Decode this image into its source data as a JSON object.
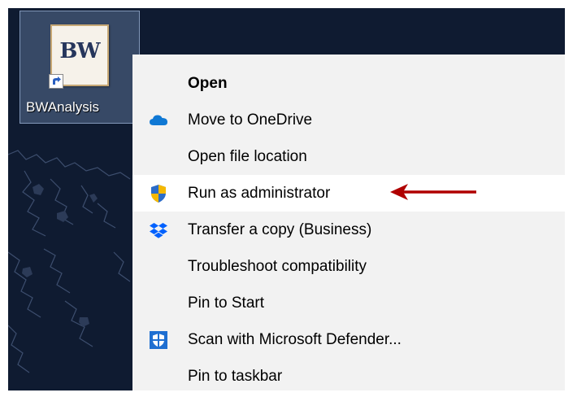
{
  "desktop": {
    "shortcut": {
      "label": "BWAnalysis",
      "icon": "bw-app-icon",
      "logo_text": "BW",
      "overlay": "shortcut-arrow-icon"
    },
    "background": "world-map-wallpaper"
  },
  "context_menu": {
    "items": [
      {
        "label": "Open",
        "bold": true,
        "icon": null
      },
      {
        "label": "Move to OneDrive",
        "icon": "onedrive-icon"
      },
      {
        "label": "Open file location",
        "icon": null
      },
      {
        "label": "Run as administrator",
        "icon": "uac-shield-icon",
        "highlighted": true
      },
      {
        "label": "Transfer a copy (Business)",
        "icon": "dropbox-icon"
      },
      {
        "label": "Troubleshoot compatibility",
        "icon": null
      },
      {
        "label": "Pin to Start",
        "icon": null
      },
      {
        "label": "Scan with Microsoft Defender...",
        "icon": "defender-icon"
      },
      {
        "label": "Pin to taskbar",
        "icon": null
      }
    ]
  },
  "annotation": {
    "arrow_color": "#b00000",
    "points_to": "Run as administrator"
  },
  "colors": {
    "desktop_bg": "#0f1b31",
    "menu_bg": "#f2f2f2",
    "highlight_bg": "#ffffff",
    "onedrive_blue": "#0f78d4",
    "dropbox_blue": "#0061fe",
    "defender_blue": "#1f6fd1",
    "shield_yellow": "#f5b800",
    "shield_blue": "#2b6cc9"
  }
}
